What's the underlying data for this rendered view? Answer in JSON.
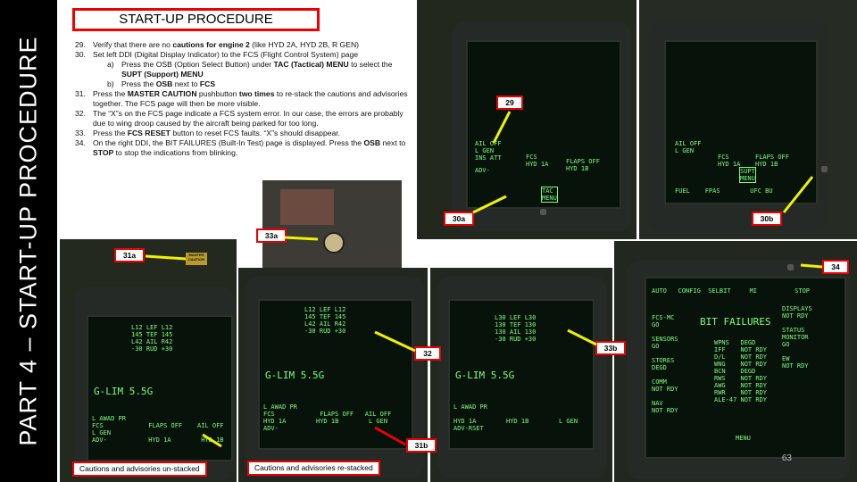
{
  "side_title": "PART 4 – START-UP PROCEDURE",
  "section_title": "START-UP PROCEDURE",
  "steps": [
    {
      "num": "29.",
      "html": "Verify that there are no <b>cautions for engine 2</b> (like HYD 2A, HYD 2B, R GEN)"
    },
    {
      "num": "30.",
      "html": "Set left DDI (Digital Display Indicator) to the FCS (Flight Control System) page"
    },
    {
      "num": "a)",
      "html": "Press the OSB (Option Select Button) under <b>TAC (Tactical) MENU</b> to select the <b>SUPT (Support) MENU</b>",
      "sub": true
    },
    {
      "num": "b)",
      "html": "Press the <b>OSB</b> next to <b>FCS</b>",
      "sub": true
    },
    {
      "num": "31.",
      "html": "Press the <b>MASTER CAUTION</b> pushbutton <b>two times</b> to re-stack the cautions and advisories together. The FCS page will then be more visible."
    },
    {
      "num": "32.",
      "html": "The “X”s on the FCS page indicate a FCS system error. In our case, the errors are probably due to wing droop caused by the aircraft being parked for too long."
    },
    {
      "num": "33.",
      "html": "Press the <b>FCS RESET</b> button to reset FCS faults. “X”s should disappear."
    },
    {
      "num": "34.",
      "html": "On the right DDI, the BIT FAILURES (Built-In Test) page is displayed. Press the <b>OSB</b> next to <b>STOP</b> to stop the indications from blinking."
    }
  ],
  "tags": {
    "t29": "29",
    "t30a": "30a",
    "t30b": "30b",
    "t31a": "31a",
    "t31b": "31b",
    "t32": "32",
    "t33a": "33a",
    "t33b": "33b",
    "t34": "34"
  },
  "captions": {
    "unstacked": "Cautions and advisories un-stacked",
    "restacked": "Cautions and advisories re-stacked"
  },
  "page_number": "63",
  "ddi1": {
    "left": "AIL OFF\nL GEN\nINS ATT",
    "mid": "FCS\nHYD 1A",
    "right": "FLAPS OFF\nHYD 1B",
    "osb": "TAC\nMENU",
    "bottom": "ADV-"
  },
  "ddi2": {
    "left": "AIL OFF\nL GEN",
    "mid": "FCS\nHYD 1A",
    "right": "FLAPS OFF\nHYD 1B",
    "osb": "SUPT\nMENU",
    "bottom": "FUEL    FPAS        UFC BU"
  },
  "fcs_a": {
    "header": "L12 LEF L12\n145 TEF 145\nL42 AIL R42\n-30 RUD +30",
    "glim": "G-LIM 5.5G",
    "warn": "L AWAD PR\nFCS            FLAPS OFF    AIL OFF\nL GEN\nADV-           HYD 1A        HYD 1B"
  },
  "fcs_b": {
    "header": "L12 LEF L12\n145 TEF 145\nL42 AIL R42\n-30 RUD +30",
    "glim": "G-LIM 5.5G",
    "warn": "L AWAD PR\nFCS            FLAPS OFF   AIL OFF\nHYD 1A        HYD 1B        L GEN\nADV-"
  },
  "fcs_c": {
    "header": "L30 LEF L30\n130 TEF 130\n130 AIL 130\n-30 RUD +30",
    "glim": "G-LIM 5.5G",
    "warn": "L AWAD PR\n\nHYD 1A        HYD 1B        L GEN\nADV-RSET"
  },
  "bit": {
    "top": "AUTO   CONFIG  SELBIT     MI          STOP",
    "title": "BIT FAILURES",
    "left": "FCS-MC\nGO\n\nSENSORS\nGO\n\nSTORES\nDEGD\n\nCOMM\nNOT RDY\n\nNAV\nNOT RDY",
    "mid": "WPNS   DEGD\nIFF    NOT RDY\nD/L    NOT RDY\nWNG    NOT RDY\nBCN    DEGD\nRWS    NOT RDY\nAWG    NOT RDY\nRWR    NOT RDY\nALE-47 NOT RDY",
    "right": "DISPLAYS\nNOT RDY\n\nSTATUS\nMONITOR\nGO\n\nEW\nNOT RDY",
    "bottom": "MENU"
  },
  "master_caution": "MASTER\nCAUTION",
  "colors": {
    "accent_red": "#e00000",
    "mfd_green": "#7cff7c",
    "sidebar": "#000000",
    "arrow_yellow": "#f2f200"
  }
}
